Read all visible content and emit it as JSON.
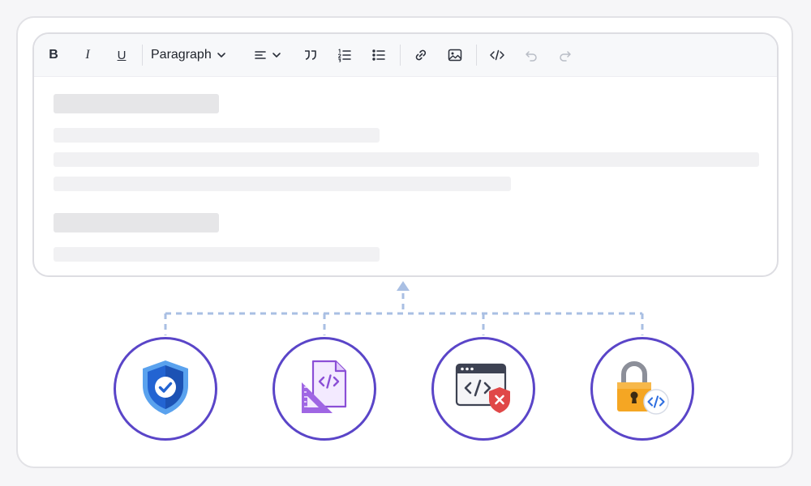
{
  "toolbar": {
    "bold_label": "B",
    "italic_label": "I",
    "underline_label": "U",
    "block_format": {
      "selected": "Paragraph"
    },
    "icons": {
      "align": "align-left-icon",
      "quote": "blockquote-icon",
      "ordered": "ordered-list-icon",
      "bullet": "bullet-list-icon",
      "link": "link-icon",
      "image": "image-icon",
      "code": "code-icon",
      "undo": "undo-icon",
      "redo": "redo-icon"
    }
  },
  "features": [
    {
      "name": "security-shield",
      "icon": "shield-check-icon",
      "color": "#2f6fe0"
    },
    {
      "name": "code-document",
      "icon": "code-document-icon",
      "color": "#8b4fd6"
    },
    {
      "name": "code-blocked",
      "icon": "browser-code-blocked-icon",
      "color": "#e04848"
    },
    {
      "name": "locked-code",
      "icon": "padlock-code-icon",
      "color": "#f5a623"
    }
  ],
  "colors": {
    "accent": "#5a45c8",
    "connector": "#a9bfe3"
  }
}
